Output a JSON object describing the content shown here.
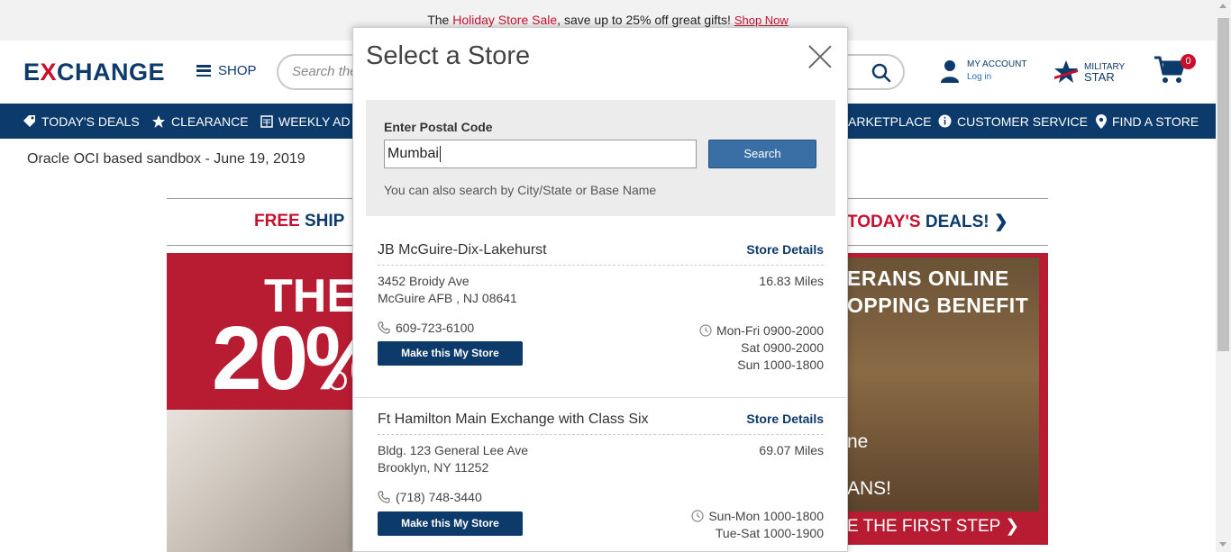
{
  "promo": {
    "prefix": "The ",
    "highlight": "Holiday Store Sale",
    "suffix": ", save up to 25% off great gifts! ",
    "link": "Shop Now"
  },
  "header": {
    "logo_pre": "E",
    "logo_x": "X",
    "logo_post": "CHANGE",
    "shop_label": "SHOP",
    "search_placeholder": "Search the",
    "account_title": "MY ACCOUNT",
    "account_login": "Log in",
    "milstar_line1": "MILITARY",
    "milstar_line2": "STAR",
    "cart_count": "0"
  },
  "nav": {
    "todays_deals": "TODAY'S DEALS",
    "clearance": "CLEARANCE",
    "weekly_ad": "WEEKLY AD",
    "marketplace": "ARKETPLACE",
    "customer_service": "CUSTOMER SERVICE",
    "find_store": "FIND A STORE"
  },
  "sandbox_note": "Oracle OCI based sandbox - June 19, 2019",
  "background": {
    "free_ship_red": "FREE ",
    "free_ship_dark": "SHIP",
    "todays_red": "TODAY'S ",
    "todays_dark": "DEALS! ❯",
    "left_banner_the": "THE",
    "left_banner_pct": "20%",
    "left_banner_o": "O",
    "right_banner_l1": "ERANS ONLINE",
    "right_banner_l2": "OPPING BENEFIT",
    "right_banner_l3": "ne",
    "right_banner_l4": "ANS!",
    "right_banner_cta": "E THE FIRST STEP ❯"
  },
  "modal": {
    "title": "Select a Store",
    "postal_label": "Enter Postal Code",
    "postal_value": "Mumbai",
    "search_button": "Search",
    "hint": "You can also search by City/State or Base Name"
  },
  "stores": [
    {
      "name": "JB McGuire-Dix-Lakehurst",
      "details_link": "Store Details",
      "address1": "3452 Broidy Ave",
      "address2": "McGuire AFB , NJ 08641",
      "miles": "16.83 Miles",
      "phone": "609-723-6100",
      "button": "Make this My Store",
      "hours": [
        "Mon-Fri 0900-2000",
        "Sat 0900-2000",
        "Sun 1000-1800"
      ]
    },
    {
      "name": "Ft Hamilton Main Exchange with Class Six",
      "details_link": "Store Details",
      "address1": "Bldg. 123 General Lee Ave",
      "address2": "Brooklyn, NY 11252",
      "miles": "69.07 Miles",
      "phone": "(718) 748-3440",
      "button": "Make this My Store",
      "hours": [
        "Sun-Mon 1000-1800",
        "Tue-Sat 1000-1900"
      ]
    }
  ],
  "colors": {
    "brand_navy": "#0c3a6b",
    "brand_red": "#c8102e",
    "button_blue": "#3a6fa5"
  }
}
